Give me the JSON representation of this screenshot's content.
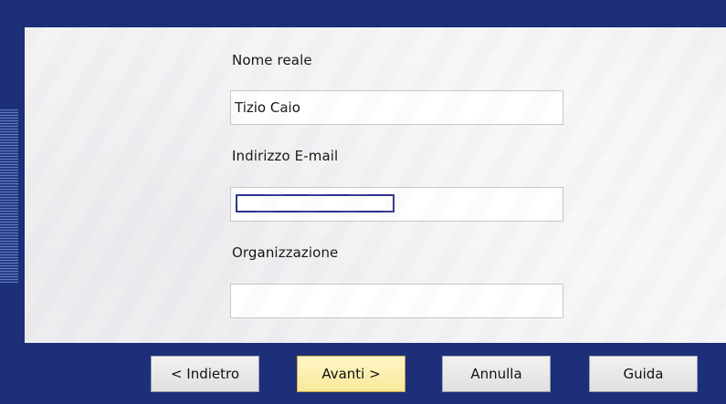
{
  "form": {
    "real_name": {
      "label": "Nome reale",
      "value": "Tizio Caio"
    },
    "email": {
      "label": "Indirizzo E-mail",
      "value": ""
    },
    "organization": {
      "label": "Organizzazione",
      "value": ""
    }
  },
  "buttons": {
    "back": "< Indietro",
    "next": "Avanti >",
    "cancel": "Annulla",
    "help": "Guida"
  },
  "colors": {
    "frame": "#1c2f78",
    "panel": "#f0f0f2",
    "focus_ring": "#2a2f8c",
    "primary_button": "#f8e99a"
  }
}
